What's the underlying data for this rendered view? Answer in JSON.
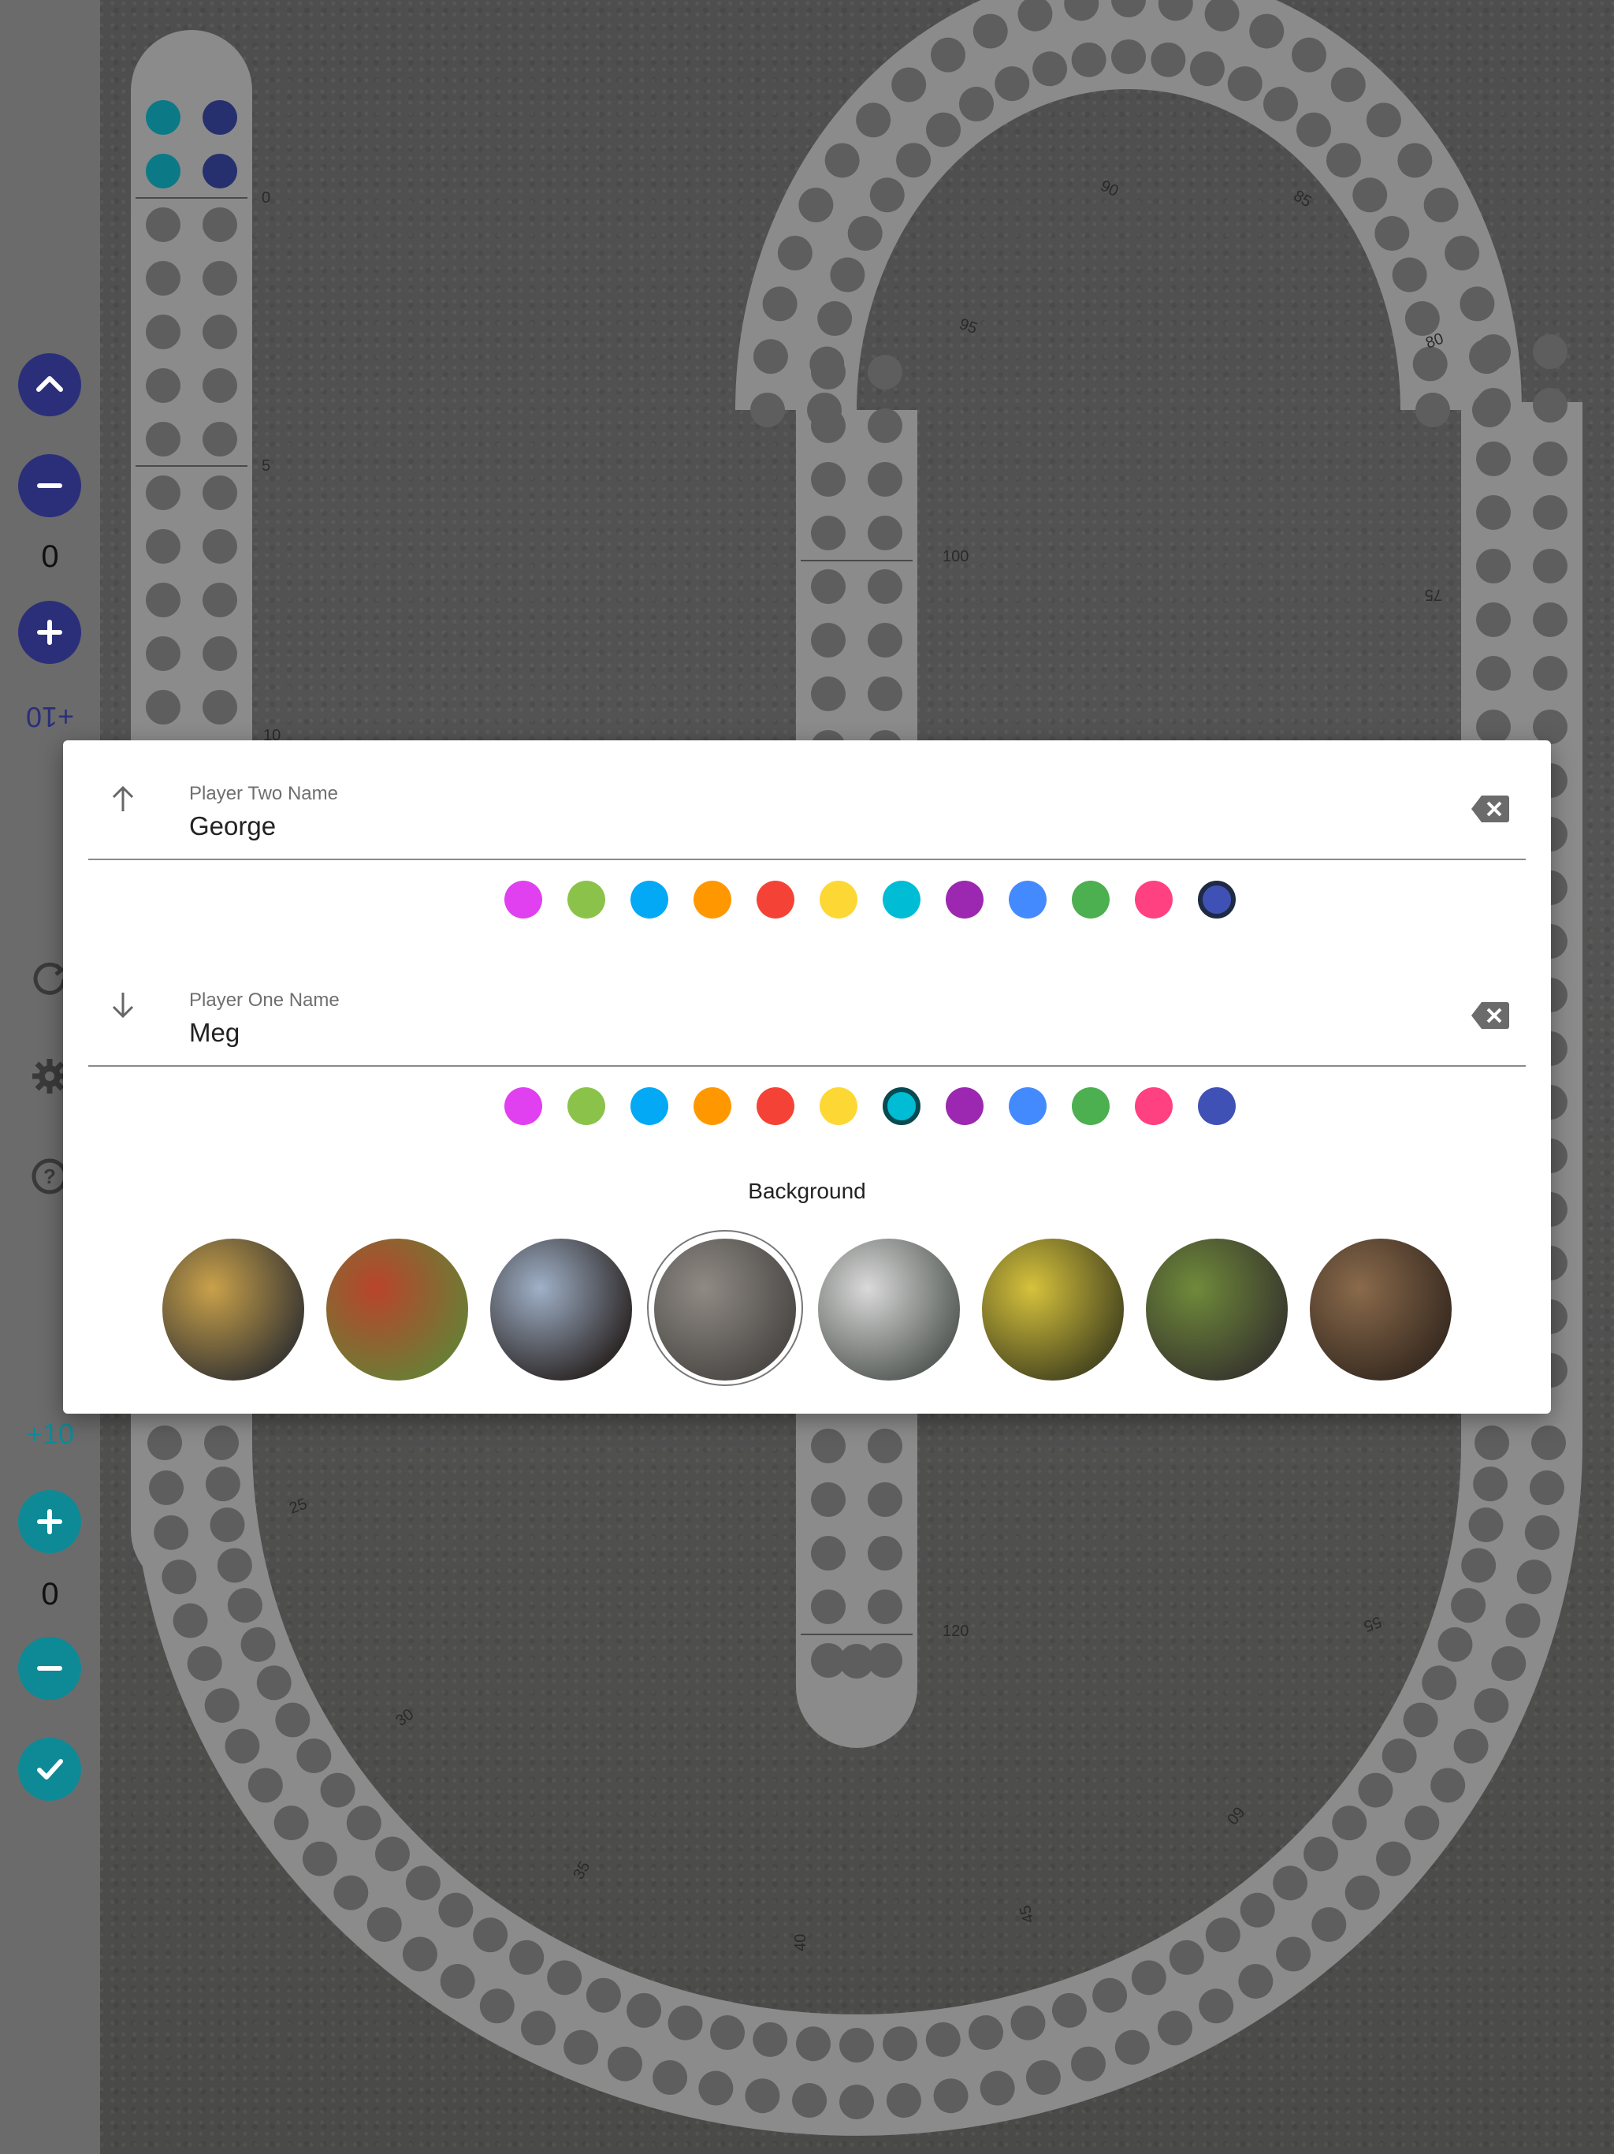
{
  "board": {
    "left_scale": [
      "0",
      "5",
      "10"
    ],
    "ring_labels": [
      "90",
      "85",
      "95",
      "80",
      "100",
      "75",
      "25",
      "30",
      "35",
      "40",
      "45",
      "120",
      "55",
      "60"
    ],
    "colors": {
      "track": "#8b8b8b",
      "hole": "#5e5e5e",
      "label": "#2a2a2a"
    }
  },
  "rail": {
    "player_two": {
      "score": "0",
      "plus_ten": "+10",
      "color": "#2b2f7a"
    },
    "player_one": {
      "score": "0",
      "plus_ten": "+10",
      "color": "#0e8a97"
    },
    "icons": [
      "chevron-up-icon",
      "minus-icon",
      "plus-icon",
      "refresh-icon",
      "gear-icon",
      "help-icon",
      "plus-icon",
      "minus-icon",
      "check-icon"
    ]
  },
  "pegs": {
    "player_two_color": "#27306e",
    "player_one_color": "#0b7a86"
  },
  "dialog": {
    "player_two": {
      "label": "Player Two Name",
      "value": "George"
    },
    "player_one": {
      "label": "Player One Name",
      "value": "Meg"
    },
    "palette": [
      "#e040f0",
      "#8bc34a",
      "#03a9f4",
      "#ff9800",
      "#f44336",
      "#fdd835",
      "#00bcd4",
      "#9c27b0",
      "#448aff",
      "#4caf50",
      "#ff4081",
      "#3f51b5"
    ],
    "player_two_selected": 11,
    "player_one_selected": 6,
    "background_title": "Background",
    "backgrounds": [
      {
        "name": "rocks-water",
        "c1": "#c9a14a",
        "c2": "#3d3a33"
      },
      {
        "name": "autumn-tree",
        "c1": "#b9442c",
        "c2": "#6b7d34"
      },
      {
        "name": "ice",
        "c1": "#9fb0c7",
        "c2": "#2f2a2a"
      },
      {
        "name": "gravel-snail",
        "c1": "#8f8a84",
        "c2": "#4d4a47"
      },
      {
        "name": "snowy-forest",
        "c1": "#d9d9d9",
        "c2": "#5a5f5b"
      },
      {
        "name": "yellow-larch",
        "c1": "#d6c23c",
        "c2": "#4c4a20"
      },
      {
        "name": "forest-floor",
        "c1": "#6f8a3a",
        "c2": "#3a3a2e"
      },
      {
        "name": "pink-flowers",
        "c1": "#8a6a4b",
        "c2": "#3b2d22"
      }
    ],
    "selected_background": 3
  }
}
